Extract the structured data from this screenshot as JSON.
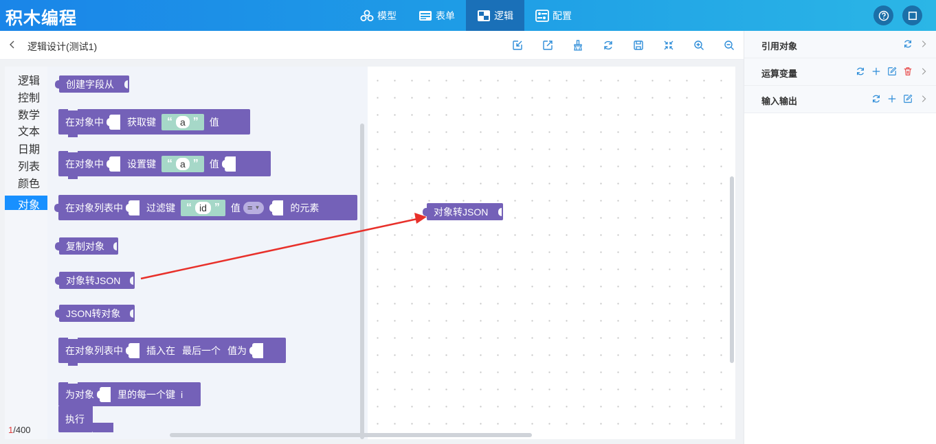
{
  "app": {
    "title": "积木编程"
  },
  "nav": {
    "tabs": [
      {
        "label": "模型"
      },
      {
        "label": "表单"
      },
      {
        "label": "逻辑",
        "active": true
      },
      {
        "label": "配置"
      }
    ]
  },
  "header_actions": {
    "help_icon": "question-circle-icon",
    "window_icon": "window-square-icon"
  },
  "subbar": {
    "back_icon": "chevron-left-icon",
    "title": "逻辑设计(测试1)"
  },
  "toolbar": {
    "icons": [
      "import-icon",
      "export-icon",
      "clean-up-icon",
      "refresh-icon",
      "save-icon",
      "collapse-icon",
      "zoom-in-icon",
      "zoom-out-icon"
    ]
  },
  "categories": [
    "逻辑",
    "控制",
    "数学",
    "文本",
    "日期",
    "列表",
    "颜色",
    "对象"
  ],
  "active_category": "对象",
  "counter": {
    "current": "1",
    "total": "/400"
  },
  "blocks": {
    "create_fields": {
      "label": "创建字段从"
    },
    "get_key": {
      "prefix": "在对象中",
      "mid": "获取键",
      "open_quote": "“",
      "value": "a",
      "close_quote": "”",
      "suffix": "值"
    },
    "set_key": {
      "prefix": "在对象中",
      "mid": "设置键",
      "open_quote": "“",
      "value": "a",
      "close_quote": "”",
      "suffix": "值"
    },
    "filter_key": {
      "prefix": "在对象列表中",
      "mid": "过滤键",
      "open_quote": "“",
      "value": "id",
      "close_quote": "”",
      "value_label": "值",
      "operator": "=",
      "suffix": "的元素"
    },
    "copy_object": {
      "label": "复制对象"
    },
    "object_to_json": {
      "label": "对象转JSON"
    },
    "json_to_object": {
      "label": "JSON转对象"
    },
    "insert_at": {
      "prefix": "在对象列表中",
      "mid": "插入在",
      "position": "最后一个",
      "suffix": "值为"
    },
    "for_each_key": {
      "prefix": "为对象",
      "mid": "里的每一个键",
      "var": "i",
      "do": "执行"
    }
  },
  "workspace_block": {
    "label": "对象转JSON"
  },
  "annotation": {
    "color": "#e8302a"
  },
  "right_panel": {
    "rows": [
      {
        "label": "引用对象"
      },
      {
        "label": "运算变量"
      },
      {
        "label": "输入输出"
      }
    ]
  },
  "colors": {
    "block": "#7461b8",
    "string_field": "#a6d8c8",
    "nav_active": "#1a70b8",
    "accent": "#1890ff",
    "delete": "#e84a4a"
  }
}
